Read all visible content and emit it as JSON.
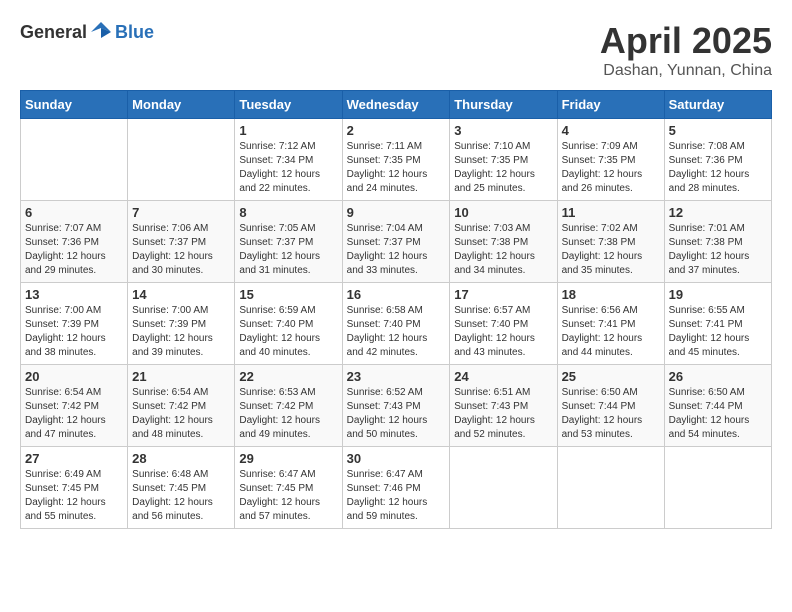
{
  "header": {
    "logo_general": "General",
    "logo_blue": "Blue",
    "month": "April 2025",
    "location": "Dashan, Yunnan, China"
  },
  "weekdays": [
    "Sunday",
    "Monday",
    "Tuesday",
    "Wednesday",
    "Thursday",
    "Friday",
    "Saturday"
  ],
  "weeks": [
    [
      null,
      null,
      {
        "day": 1,
        "sunrise": "7:12 AM",
        "sunset": "7:34 PM",
        "daylight": "12 hours and 22 minutes."
      },
      {
        "day": 2,
        "sunrise": "7:11 AM",
        "sunset": "7:35 PM",
        "daylight": "12 hours and 24 minutes."
      },
      {
        "day": 3,
        "sunrise": "7:10 AM",
        "sunset": "7:35 PM",
        "daylight": "12 hours and 25 minutes."
      },
      {
        "day": 4,
        "sunrise": "7:09 AM",
        "sunset": "7:35 PM",
        "daylight": "12 hours and 26 minutes."
      },
      {
        "day": 5,
        "sunrise": "7:08 AM",
        "sunset": "7:36 PM",
        "daylight": "12 hours and 28 minutes."
      }
    ],
    [
      {
        "day": 6,
        "sunrise": "7:07 AM",
        "sunset": "7:36 PM",
        "daylight": "12 hours and 29 minutes."
      },
      {
        "day": 7,
        "sunrise": "7:06 AM",
        "sunset": "7:37 PM",
        "daylight": "12 hours and 30 minutes."
      },
      {
        "day": 8,
        "sunrise": "7:05 AM",
        "sunset": "7:37 PM",
        "daylight": "12 hours and 31 minutes."
      },
      {
        "day": 9,
        "sunrise": "7:04 AM",
        "sunset": "7:37 PM",
        "daylight": "12 hours and 33 minutes."
      },
      {
        "day": 10,
        "sunrise": "7:03 AM",
        "sunset": "7:38 PM",
        "daylight": "12 hours and 34 minutes."
      },
      {
        "day": 11,
        "sunrise": "7:02 AM",
        "sunset": "7:38 PM",
        "daylight": "12 hours and 35 minutes."
      },
      {
        "day": 12,
        "sunrise": "7:01 AM",
        "sunset": "7:38 PM",
        "daylight": "12 hours and 37 minutes."
      }
    ],
    [
      {
        "day": 13,
        "sunrise": "7:00 AM",
        "sunset": "7:39 PM",
        "daylight": "12 hours and 38 minutes."
      },
      {
        "day": 14,
        "sunrise": "7:00 AM",
        "sunset": "7:39 PM",
        "daylight": "12 hours and 39 minutes."
      },
      {
        "day": 15,
        "sunrise": "6:59 AM",
        "sunset": "7:40 PM",
        "daylight": "12 hours and 40 minutes."
      },
      {
        "day": 16,
        "sunrise": "6:58 AM",
        "sunset": "7:40 PM",
        "daylight": "12 hours and 42 minutes."
      },
      {
        "day": 17,
        "sunrise": "6:57 AM",
        "sunset": "7:40 PM",
        "daylight": "12 hours and 43 minutes."
      },
      {
        "day": 18,
        "sunrise": "6:56 AM",
        "sunset": "7:41 PM",
        "daylight": "12 hours and 44 minutes."
      },
      {
        "day": 19,
        "sunrise": "6:55 AM",
        "sunset": "7:41 PM",
        "daylight": "12 hours and 45 minutes."
      }
    ],
    [
      {
        "day": 20,
        "sunrise": "6:54 AM",
        "sunset": "7:42 PM",
        "daylight": "12 hours and 47 minutes."
      },
      {
        "day": 21,
        "sunrise": "6:54 AM",
        "sunset": "7:42 PM",
        "daylight": "12 hours and 48 minutes."
      },
      {
        "day": 22,
        "sunrise": "6:53 AM",
        "sunset": "7:42 PM",
        "daylight": "12 hours and 49 minutes."
      },
      {
        "day": 23,
        "sunrise": "6:52 AM",
        "sunset": "7:43 PM",
        "daylight": "12 hours and 50 minutes."
      },
      {
        "day": 24,
        "sunrise": "6:51 AM",
        "sunset": "7:43 PM",
        "daylight": "12 hours and 52 minutes."
      },
      {
        "day": 25,
        "sunrise": "6:50 AM",
        "sunset": "7:44 PM",
        "daylight": "12 hours and 53 minutes."
      },
      {
        "day": 26,
        "sunrise": "6:50 AM",
        "sunset": "7:44 PM",
        "daylight": "12 hours and 54 minutes."
      }
    ],
    [
      {
        "day": 27,
        "sunrise": "6:49 AM",
        "sunset": "7:45 PM",
        "daylight": "12 hours and 55 minutes."
      },
      {
        "day": 28,
        "sunrise": "6:48 AM",
        "sunset": "7:45 PM",
        "daylight": "12 hours and 56 minutes."
      },
      {
        "day": 29,
        "sunrise": "6:47 AM",
        "sunset": "7:45 PM",
        "daylight": "12 hours and 57 minutes."
      },
      {
        "day": 30,
        "sunrise": "6:47 AM",
        "sunset": "7:46 PM",
        "daylight": "12 hours and 59 minutes."
      },
      null,
      null,
      null
    ]
  ]
}
